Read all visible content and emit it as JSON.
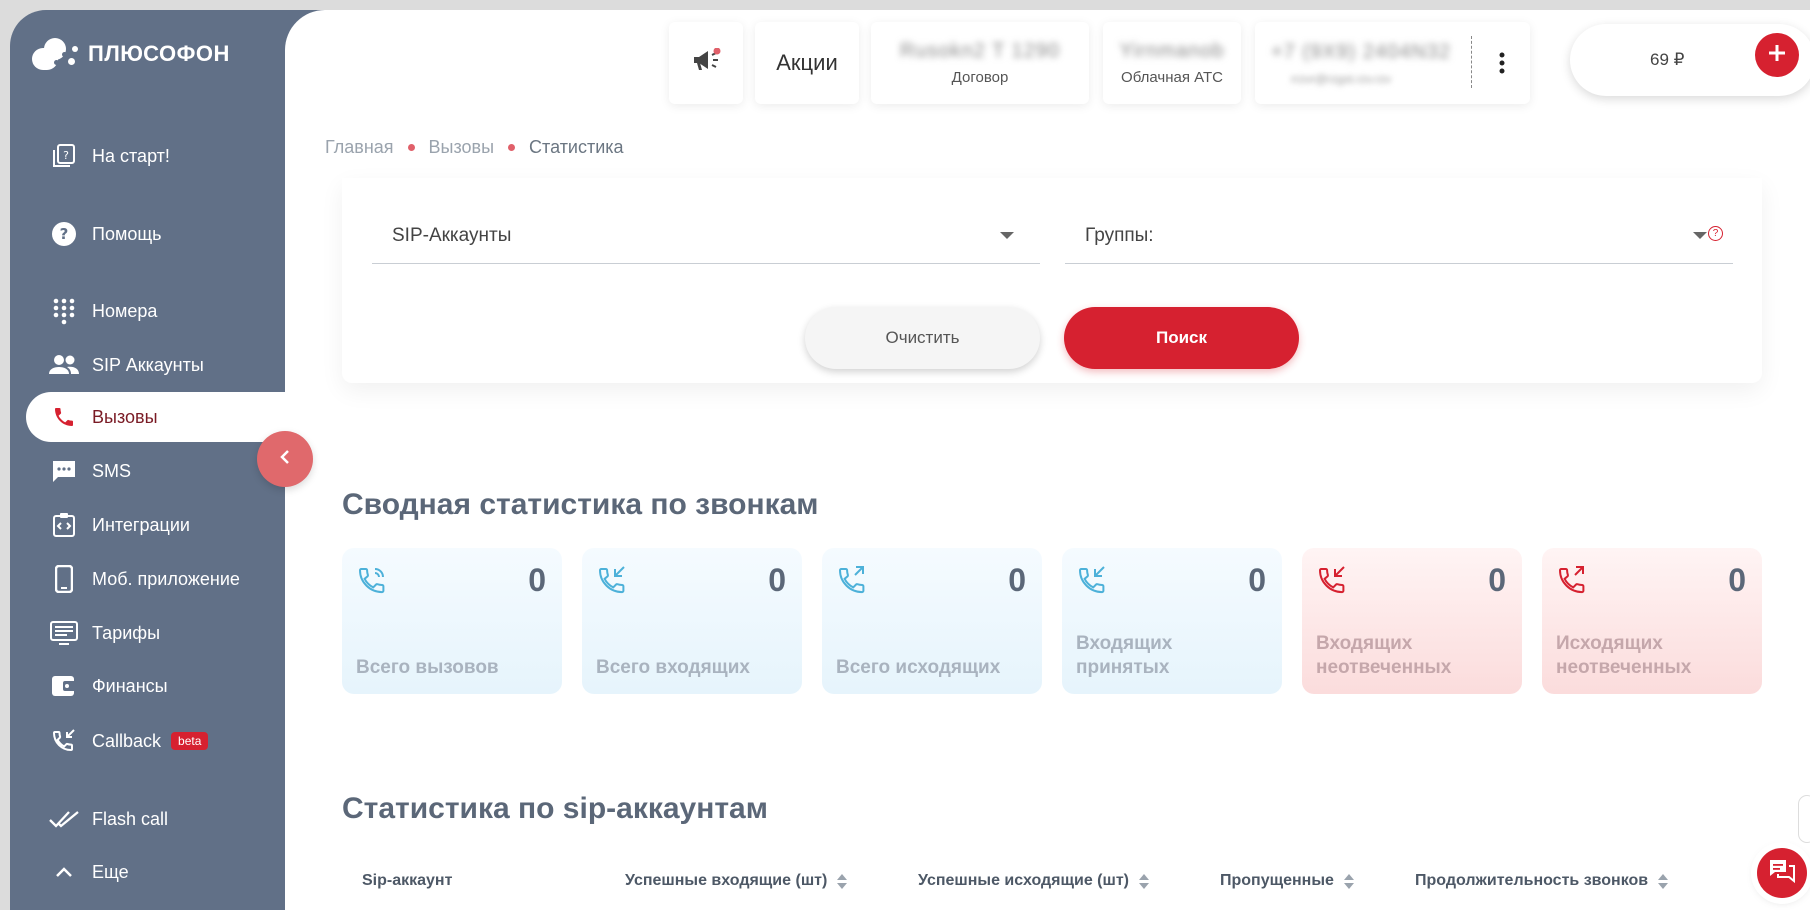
{
  "brand": {
    "name": "ПЛЮСОФОН"
  },
  "sidebar": {
    "items": [
      {
        "label": "На старт!",
        "icon": "start-icon"
      },
      {
        "label": "Помощь",
        "icon": "help-icon"
      },
      {
        "label": "Номера",
        "icon": "dialpad-icon"
      },
      {
        "label": "SIP Аккаунты",
        "icon": "users-icon"
      },
      {
        "label": "Вызовы",
        "icon": "phone-icon",
        "active": true
      },
      {
        "label": "SMS",
        "icon": "sms-icon"
      },
      {
        "label": "Интеграции",
        "icon": "integrations-icon"
      },
      {
        "label": "Моб. приложение",
        "icon": "mobile-icon"
      },
      {
        "label": "Тарифы",
        "icon": "tariffs-icon"
      },
      {
        "label": "Финансы",
        "icon": "wallet-icon"
      },
      {
        "label": "Callback",
        "icon": "callback-icon",
        "badge": "beta"
      },
      {
        "label": "Flash call",
        "icon": "double-check-icon"
      },
      {
        "label": "Еще",
        "icon": "chevron-up-icon"
      }
    ]
  },
  "header": {
    "promos_label": "Акции",
    "contract_label": "Договор",
    "contract_value": "Rusokn2 T 1290",
    "service_label": "Облачная АТС",
    "service_value": "Yirnmanob",
    "phone_value": "+7 (9X9) 2404N32",
    "email_value": "rrzvr@rzgst.rzv.rzv",
    "balance": "69 ₽"
  },
  "breadcrumb": [
    "Главная",
    "Вызовы",
    "Статистика"
  ],
  "filters": {
    "sip_accounts": "SIP-Аккаунты",
    "groups": "Группы:",
    "help_mark": "?",
    "clear_label": "Очистить",
    "search_label": "Поиск"
  },
  "summary": {
    "title": "Сводная статистика по звонкам",
    "cards": [
      {
        "value": "0",
        "label_line1": "Всего вызовов",
        "label_line2": "",
        "tone": "blue",
        "icon": "phone-ring-icon"
      },
      {
        "value": "0",
        "label_line1": "Всего входящих",
        "label_line2": "",
        "tone": "blue",
        "icon": "phone-incoming-icon"
      },
      {
        "value": "0",
        "label_line1": "Всего исходящих",
        "label_line2": "",
        "tone": "blue",
        "icon": "phone-outgoing-icon"
      },
      {
        "value": "0",
        "label_line1": "Входящих",
        "label_line2": "принятых",
        "tone": "blue",
        "icon": "phone-incoming-icon"
      },
      {
        "value": "0",
        "label_line1": "Входящих",
        "label_line2": "неотвеченных",
        "tone": "red",
        "icon": "phone-incoming-icon"
      },
      {
        "value": "0",
        "label_line1": "Исходящих",
        "label_line2": "неотвеченных",
        "tone": "red",
        "icon": "phone-outgoing-icon"
      }
    ]
  },
  "sip_stats": {
    "title": "Статистика по sip-аккаунтам",
    "columns": [
      "Sip-аккаунт",
      "Успешные входящие (шт)",
      "Успешные исходящие (шт)",
      "Пропущенные",
      "Продолжительность звонков"
    ]
  },
  "colors": {
    "sidebar": "#617087",
    "accent": "#d62130",
    "title": "#5b6778"
  }
}
